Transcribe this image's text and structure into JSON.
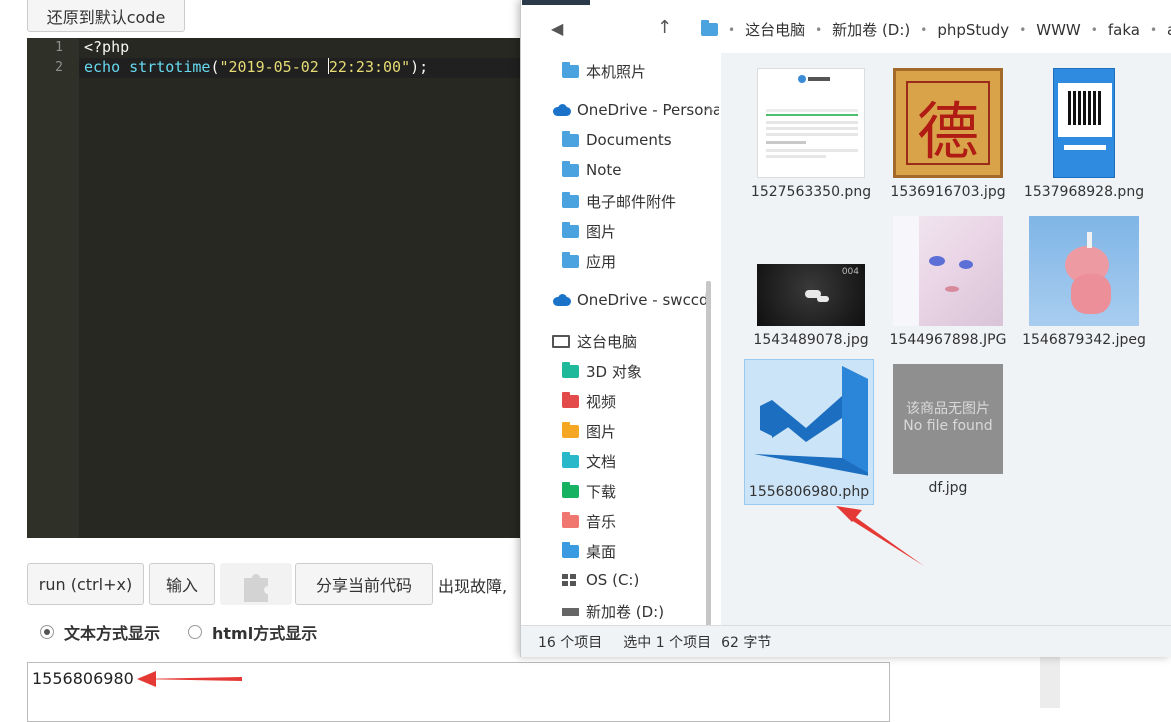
{
  "runner": {
    "reset_label": "还原到默认code",
    "code": {
      "line_numbers": [
        "1",
        "2"
      ],
      "line1": "<?php",
      "line2_kw": "echo",
      "line2_fn": "strtotime",
      "line2_open": "(",
      "line2_str_a": "\"2019-05-02 ",
      "line2_str_b": "22:23:00\"",
      "line2_close": ");"
    },
    "buttons": {
      "run": "run (ctrl+x)",
      "input": "输入",
      "share": "分享当前代码"
    },
    "fault_text": "出现故障,",
    "display_modes": {
      "text_label": "文本方式显示",
      "html_label": "html方式显示",
      "selected": "text"
    },
    "output": "1556806980"
  },
  "explorer": {
    "breadcrumb": [
      "这台电脑",
      "新加卷 (D:)",
      "phpStudy",
      "WWW",
      "faka",
      "ass"
    ],
    "nav": {
      "items": [
        {
          "label": "本机照片",
          "icon": "folder-icon",
          "color": "#4aa3df"
        },
        {
          "label": "OneDrive - Persona",
          "icon": "onedrive-icon"
        },
        {
          "label": "Documents",
          "icon": "folder-icon",
          "color": "#4aa3df"
        },
        {
          "label": "Note",
          "icon": "folder-icon",
          "color": "#4aa3df"
        },
        {
          "label": "电子邮件附件",
          "icon": "folder-icon",
          "color": "#4aa3df"
        },
        {
          "label": "图片",
          "icon": "folder-icon",
          "color": "#4aa3df"
        },
        {
          "label": "应用",
          "icon": "folder-icon",
          "color": "#4aa3df"
        },
        {
          "label": "OneDrive - swccd",
          "icon": "onedrive-icon"
        },
        {
          "label": "这台电脑",
          "icon": "pc-icon"
        },
        {
          "label": "3D 对象",
          "icon": "folder-icon",
          "color": "#1db99a"
        },
        {
          "label": "视频",
          "icon": "folder-icon",
          "color": "#e34a4a"
        },
        {
          "label": "图片",
          "icon": "folder-icon",
          "color": "#f5a623"
        },
        {
          "label": "文档",
          "icon": "folder-icon",
          "color": "#28b8c9"
        },
        {
          "label": "下载",
          "icon": "folder-icon",
          "color": "#16b262"
        },
        {
          "label": "音乐",
          "icon": "folder-icon",
          "color": "#f0776f"
        },
        {
          "label": "桌面",
          "icon": "folder-icon",
          "color": "#3b9be0"
        },
        {
          "label": "OS (C:)",
          "icon": "windows-drive-icon"
        },
        {
          "label": "新加卷 (D:)",
          "icon": "drive-icon"
        }
      ]
    },
    "files": [
      {
        "name": "1527563350.png",
        "icon": "screenshot-thumbnail"
      },
      {
        "name": "1536916703.jpg",
        "icon": "de-character-thumbnail",
        "glyph": "德"
      },
      {
        "name": "1537968928.png",
        "icon": "qrcode-app-thumbnail"
      },
      {
        "name": "1543489078.jpg",
        "icon": "dark-cloud-thumbnail",
        "badge": "004"
      },
      {
        "name": "1544967898.JPG",
        "icon": "anime-thumbnail"
      },
      {
        "name": "1546879342.jpeg",
        "icon": "unicorn-toy-thumbnail"
      },
      {
        "name": "1556806980.php",
        "icon": "vscode-icon",
        "selected": true
      },
      {
        "name": "df.jpg",
        "icon": "no-image-thumbnail",
        "line1": "该商品无图片",
        "line2": "No file found"
      }
    ],
    "status": {
      "count": "16 个项目",
      "selection": "选中 1 个项目",
      "size": "62 字节"
    }
  }
}
